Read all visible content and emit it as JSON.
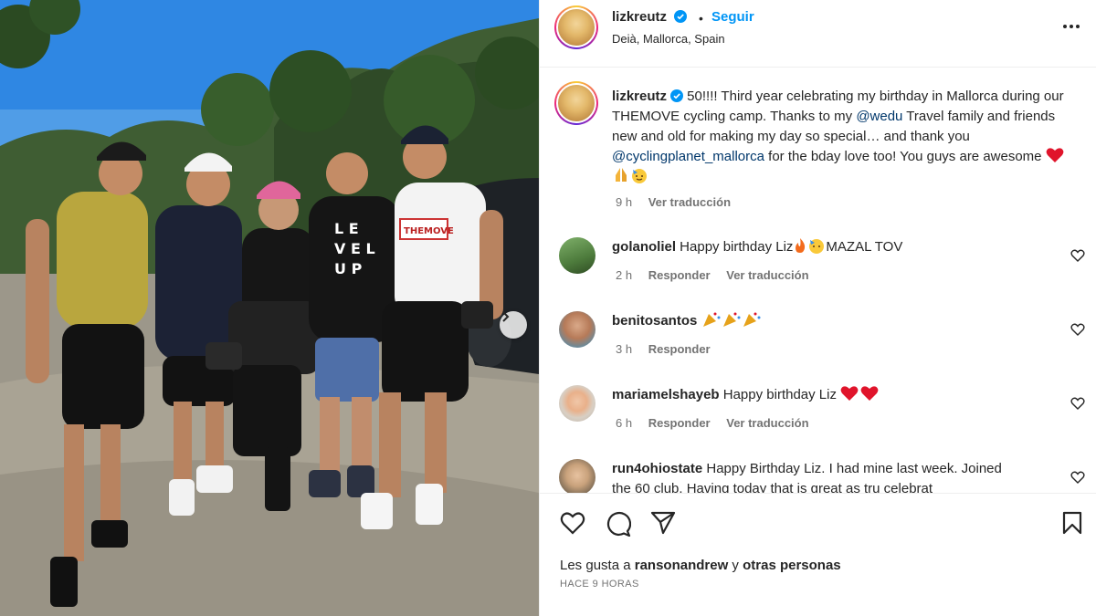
{
  "post": {
    "username": "lizkreutz",
    "follow_label": "Seguir",
    "dot": "•",
    "location": "Deià, Mallorca, Spain"
  },
  "caption": {
    "username": "lizkreutz",
    "text_1": " 50!!!! Third year celebrating my birthday in Mallorca during our THEMOVE cycling camp. Thanks to my ",
    "mention_1": "@wedu",
    "text_2": " Travel family and friends new and old for making my day so special… and thank you ",
    "mention_2": "@cyclingplanet_mallorca",
    "text_3": " for the bday love too! You guys are awesome ",
    "time": "9 h",
    "translate": "Ver traducción"
  },
  "comments": [
    {
      "username": "golanoliel",
      "text_1": " Happy birthday Liz",
      "text_2": "MAZAL TOV",
      "time": "2 h",
      "reply": "Responder",
      "translate": "Ver traducción"
    },
    {
      "username": "benitosantos",
      "text_1": " ",
      "time": "3 h",
      "reply": "Responder"
    },
    {
      "username": "mariamelshayeb",
      "text_1": " Happy birthday Liz ",
      "time": "6 h",
      "reply": "Responder",
      "translate": "Ver traducción"
    },
    {
      "username": "run4ohiostate",
      "text_1": " Happy Birthday Liz. I had mine last week. Joined",
      "text_2": "the 60 club. Having today that is great as tru celebrat"
    }
  ],
  "footer": {
    "likes_prefix": "Les gusta a ",
    "likes_user": "ransonandrew",
    "likes_suffix": " y ",
    "likes_others": "otras personas",
    "timestamp": "HACE 9 HORAS"
  },
  "colors": {
    "link": "#0095f6",
    "mention": "#00376b",
    "verified": "#0095f6",
    "secondary_text": "#737373"
  },
  "icons": [
    "verified-icon",
    "more-options-icon",
    "like-icon",
    "comment-icon",
    "share-icon",
    "save-icon",
    "next-photo-icon",
    "comment-like-icon"
  ]
}
